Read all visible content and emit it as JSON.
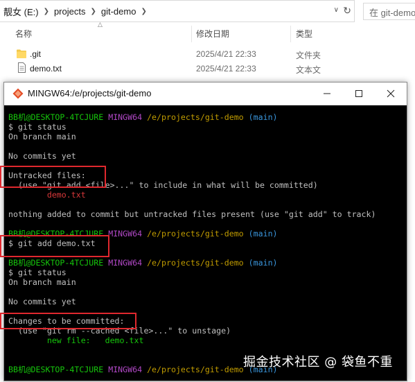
{
  "explorer": {
    "breadcrumb": [
      "靓女 (E:)",
      "projects",
      "git-demo"
    ],
    "search_placeholder": "在 git-demo",
    "columns": {
      "name": "名称",
      "date": "修改日期",
      "type": "类型"
    },
    "files": [
      {
        "name": ".git",
        "date": "2025/4/21 22:33",
        "type": "文件夹",
        "icon": "folder-icon"
      },
      {
        "name": "demo.txt",
        "date": "2025/4/21 22:33",
        "type": "文本文",
        "icon": "text-file-icon"
      }
    ]
  },
  "terminal": {
    "title": "MINGW64:/e/projects/git-demo",
    "lines": [
      {
        "segments": [
          {
            "text": "BB机@DESKTOP-4TCJURE",
            "cls": "green"
          },
          {
            "text": " MINGW64 ",
            "cls": "magenta"
          },
          {
            "text": "/e/projects/git-demo",
            "cls": "yel"
          },
          {
            "text": " (main)",
            "cls": "cyan"
          }
        ]
      },
      {
        "segments": [
          {
            "text": "$ git status",
            "cls": ""
          }
        ]
      },
      {
        "segments": [
          {
            "text": "On branch main",
            "cls": ""
          }
        ]
      },
      {
        "segments": [
          {
            "text": "",
            "cls": ""
          }
        ]
      },
      {
        "segments": [
          {
            "text": "No commits yet",
            "cls": ""
          }
        ]
      },
      {
        "segments": [
          {
            "text": "",
            "cls": ""
          }
        ]
      },
      {
        "segments": [
          {
            "text": "Untracked files:",
            "cls": ""
          }
        ]
      },
      {
        "segments": [
          {
            "text": "  (use \"git add <file>...\" to include in what will be committed)",
            "cls": ""
          }
        ]
      },
      {
        "segments": [
          {
            "text": "        demo.txt",
            "cls": "red"
          }
        ]
      },
      {
        "segments": [
          {
            "text": "",
            "cls": ""
          }
        ]
      },
      {
        "segments": [
          {
            "text": "nothing added to commit but untracked files present (use \"git add\" to track)",
            "cls": ""
          }
        ]
      },
      {
        "segments": [
          {
            "text": "",
            "cls": ""
          }
        ]
      },
      {
        "segments": [
          {
            "text": "BB机@DESKTOP-4TCJURE",
            "cls": "green"
          },
          {
            "text": " MINGW64 ",
            "cls": "magenta"
          },
          {
            "text": "/e/projects/git-demo",
            "cls": "yel"
          },
          {
            "text": " (main)",
            "cls": "cyan"
          }
        ]
      },
      {
        "segments": [
          {
            "text": "$ git add demo.txt",
            "cls": ""
          }
        ]
      },
      {
        "segments": [
          {
            "text": "",
            "cls": ""
          }
        ]
      },
      {
        "segments": [
          {
            "text": "BB机@DESKTOP-4TCJURE",
            "cls": "green"
          },
          {
            "text": " MINGW64 ",
            "cls": "magenta"
          },
          {
            "text": "/e/projects/git-demo",
            "cls": "yel"
          },
          {
            "text": " (main)",
            "cls": "cyan"
          }
        ]
      },
      {
        "segments": [
          {
            "text": "$ git status",
            "cls": ""
          }
        ]
      },
      {
        "segments": [
          {
            "text": "On branch main",
            "cls": ""
          }
        ]
      },
      {
        "segments": [
          {
            "text": "",
            "cls": ""
          }
        ]
      },
      {
        "segments": [
          {
            "text": "No commits yet",
            "cls": ""
          }
        ]
      },
      {
        "segments": [
          {
            "text": "",
            "cls": ""
          }
        ]
      },
      {
        "segments": [
          {
            "text": "Changes to be committed:",
            "cls": ""
          }
        ]
      },
      {
        "segments": [
          {
            "text": "  (use \"git rm --cached <file>...\" to unstage)",
            "cls": ""
          }
        ]
      },
      {
        "segments": [
          {
            "text": "        new file:   demo.txt",
            "cls": "dkgreen"
          }
        ]
      },
      {
        "segments": [
          {
            "text": "",
            "cls": ""
          }
        ]
      },
      {
        "segments": [
          {
            "text": "",
            "cls": ""
          }
        ]
      },
      {
        "segments": [
          {
            "text": "BB机@DESKTOP-4TCJURE",
            "cls": "green"
          },
          {
            "text": " MINGW64 ",
            "cls": "magenta"
          },
          {
            "text": "/e/projects/git-demo",
            "cls": "yel"
          },
          {
            "text": " (main)",
            "cls": "cyan"
          }
        ]
      }
    ]
  },
  "watermark": "掘金技术社区 @ 袋鱼不重",
  "colors": {
    "highlight": "#e0282e",
    "terminal_bg": "#000000"
  }
}
